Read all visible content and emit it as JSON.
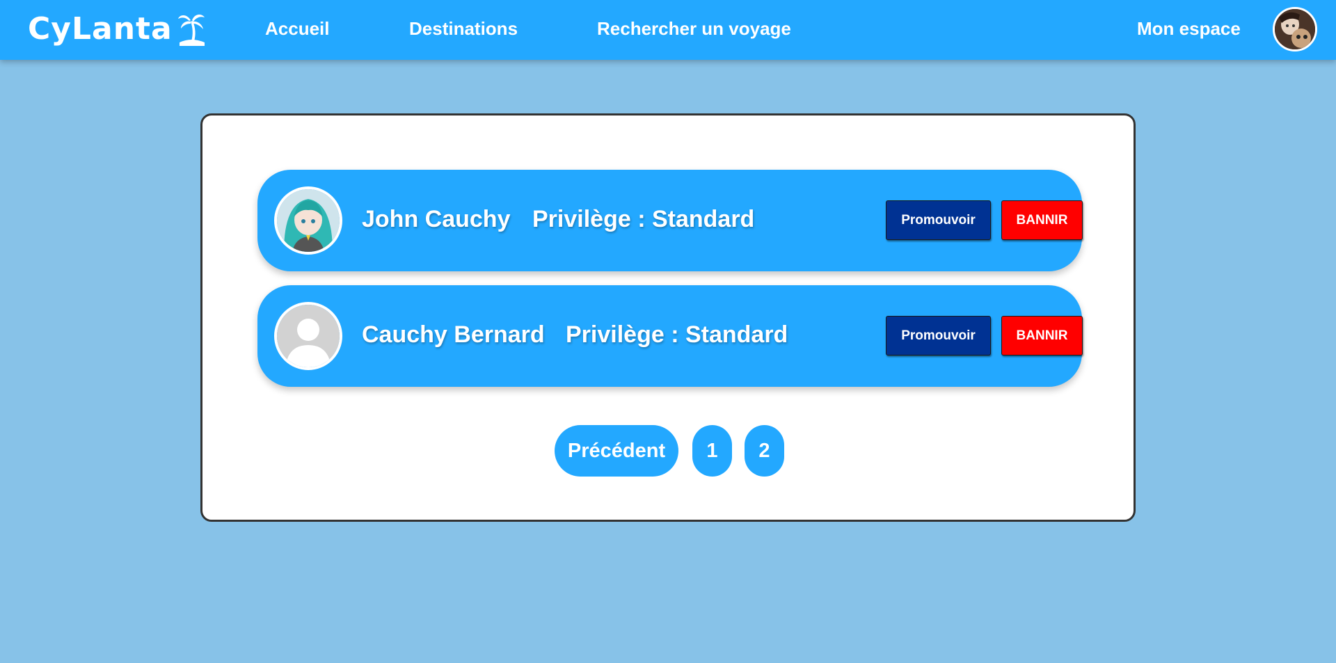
{
  "navbar": {
    "logo_text": "CyLanta",
    "links": [
      "Accueil",
      "Destinations",
      "Rechercher un voyage"
    ],
    "account_link": "Mon espace"
  },
  "users": [
    {
      "name": "John Cauchy",
      "privilege": "Privilège : Standard",
      "promote_label": "Promouvoir",
      "ban_label": "BANNIR",
      "avatar": "anime-character-avatar"
    },
    {
      "name": "Cauchy Bernard",
      "privilege": "Privilège : Standard",
      "promote_label": "Promouvoir",
      "ban_label": "BANNIR",
      "avatar": "default-user-avatar"
    }
  ],
  "pagination": {
    "previous_label": "Précédent",
    "pages": [
      "1",
      "2"
    ]
  },
  "colors": {
    "primary": "#23a8ff",
    "background": "#87c2e8",
    "promote": "#003293",
    "ban": "#ff0000"
  },
  "icons": {
    "logo_icon": "palm-tree-island-icon",
    "profile": "user-profile-avatar"
  }
}
